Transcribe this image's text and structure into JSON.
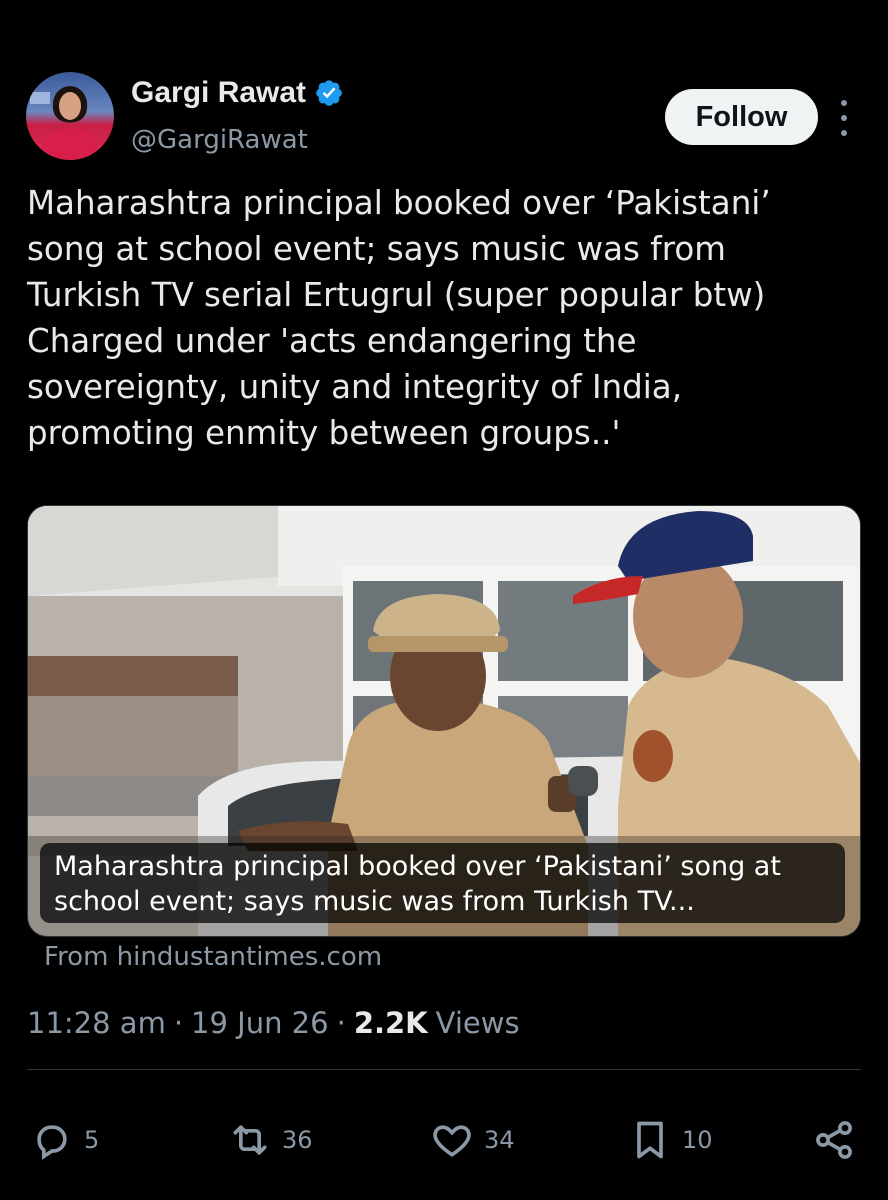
{
  "author": {
    "name": "Gargi Rawat",
    "handle": "@GargiRawat",
    "verified": true,
    "avatar_icon": "profile-photo"
  },
  "follow_label": "Follow",
  "tweet": {
    "text": "Maharashtra principal booked over ‘Pakistani’\nsong at school event; says music was from\nTurkish TV serial Ertugrul (super popular btw)\nCharged under 'acts endangering the\nsovereignty, unity and integrity of India,\npromoting enmity between groups..'"
  },
  "link_card": {
    "caption_line1": "Maharashtra principal booked over ‘Pakistani’ song at",
    "caption_line2": "school event; says music was from Turkish TV...",
    "source": "From hindustantimes.com",
    "image_icon": "police-officers-photo"
  },
  "meta": {
    "time": "11:28 am",
    "date": "19 Jun 26",
    "views_count": "2.2K",
    "views_label": "Views",
    "separator": "·"
  },
  "actions": {
    "replies": "5",
    "reposts": "36",
    "likes": "34",
    "bookmarks": "10"
  },
  "colors": {
    "background": "#000000",
    "text": "#e7e9ea",
    "secondary": "#8b98a5",
    "verified": "#1d9bf0",
    "follow_bg": "#eff3f4"
  }
}
